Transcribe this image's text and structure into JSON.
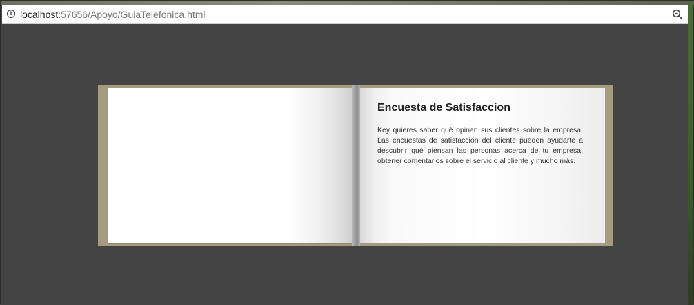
{
  "browser": {
    "url_host": "localhost",
    "url_rest": ":57656/Apoyo/GuiaTelefonica.html",
    "info_icon": "info-icon",
    "zoom_icon": "magnifier-icon"
  },
  "book": {
    "right_page": {
      "title": "Encuesta de Satisfaccion",
      "text": "Key quieres saber qué opinan sus clientes sobre la empresa. Las encuestas de satisfacción del cliente pueden ayudarte a descubrir qué piensan las personas acerca de tu empresa, obtener comentarios sobre el servicio al cliente y mucho más."
    }
  },
  "colors": {
    "background": "#444444",
    "book_cover": "#a49c7e",
    "page": "#ffffff"
  }
}
